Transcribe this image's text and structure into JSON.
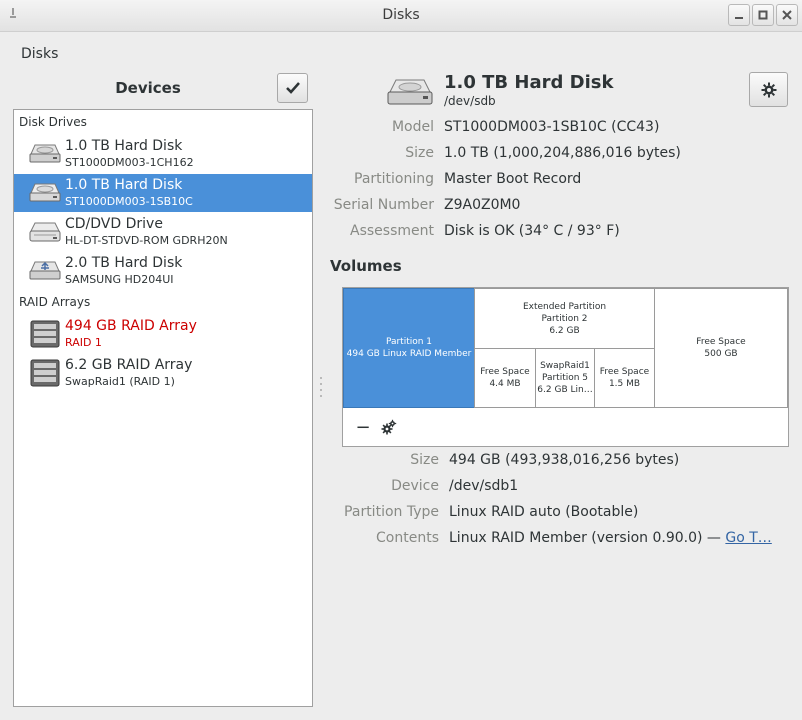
{
  "window": {
    "title": "Disks"
  },
  "menu": {
    "app_label": "Disks"
  },
  "devices_panel": {
    "title": "Devices",
    "sections": [
      {
        "label": "Disk Drives"
      },
      {
        "label": "RAID Arrays"
      }
    ],
    "items": [
      {
        "name": "1.0 TB Hard Disk",
        "sub": "ST1000DM003-1CH162",
        "icon": "harddisk-icon",
        "selected": false
      },
      {
        "name": "1.0 TB Hard Disk",
        "sub": "ST1000DM003-1SB10C",
        "icon": "harddisk-icon",
        "selected": true
      },
      {
        "name": "CD/DVD Drive",
        "sub": "HL-DT-STDVD-ROM GDRH20N",
        "icon": "optical-drive-icon",
        "selected": false
      },
      {
        "name": "2.0 TB Hard Disk",
        "sub": "SAMSUNG HD204UI",
        "icon": "usb-harddisk-icon",
        "selected": false
      },
      {
        "name": "494 GB RAID Array",
        "sub": "RAID 1",
        "icon": "raid-array-icon",
        "selected": false,
        "status_color": "#cc0000"
      },
      {
        "name": "6.2 GB RAID Array",
        "sub": "SwapRaid1 (RAID 1)",
        "icon": "raid-array-icon",
        "selected": false
      }
    ]
  },
  "disk": {
    "title": "1.0 TB Hard Disk",
    "device": "/dev/sdb",
    "properties": [
      {
        "key": "Model",
        "value": "ST1000DM003-1SB10C (CC43)"
      },
      {
        "key": "Size",
        "value": "1.0 TB (1,000,204,886,016 bytes)"
      },
      {
        "key": "Partitioning",
        "value": "Master Boot Record"
      },
      {
        "key": "Serial Number",
        "value": "Z9A0Z0M0"
      },
      {
        "key": "Assessment",
        "value": "Disk is OK (34° C / 93° F)"
      }
    ]
  },
  "volumes": {
    "title": "Volumes",
    "segments": [
      {
        "line1": "Partition 1",
        "line2": "494 GB Linux RAID Member",
        "selected": true
      },
      {
        "line1": "Extended Partition",
        "line2": "Partition 2",
        "line3": "6.2 GB"
      },
      {
        "line1": "Free Space",
        "line2": "4.4 MB"
      },
      {
        "line1": "SwapRaid1",
        "line2": "Partition 5",
        "line3": "6.2 GB Lin…"
      },
      {
        "line1": "Free Space",
        "line2": "1.5 MB"
      },
      {
        "line1": "Free Space",
        "line2": "500 GB"
      }
    ],
    "tools": {
      "remove_label": "−"
    }
  },
  "partition": {
    "properties": [
      {
        "key": "Size",
        "value": "494 GB (493,938,016,256 bytes)"
      },
      {
        "key": "Device",
        "value": "/dev/sdb1"
      },
      {
        "key": "Partition Type",
        "value": "Linux RAID auto (Bootable)"
      },
      {
        "key": "Contents",
        "value": "Linux RAID Member (version 0.90.0) — ",
        "link": "Go T…"
      }
    ]
  },
  "colors": {
    "accent": "#4a90d9",
    "degraded": "#cc0000",
    "label": "#888a85",
    "link": "#3465a4"
  }
}
